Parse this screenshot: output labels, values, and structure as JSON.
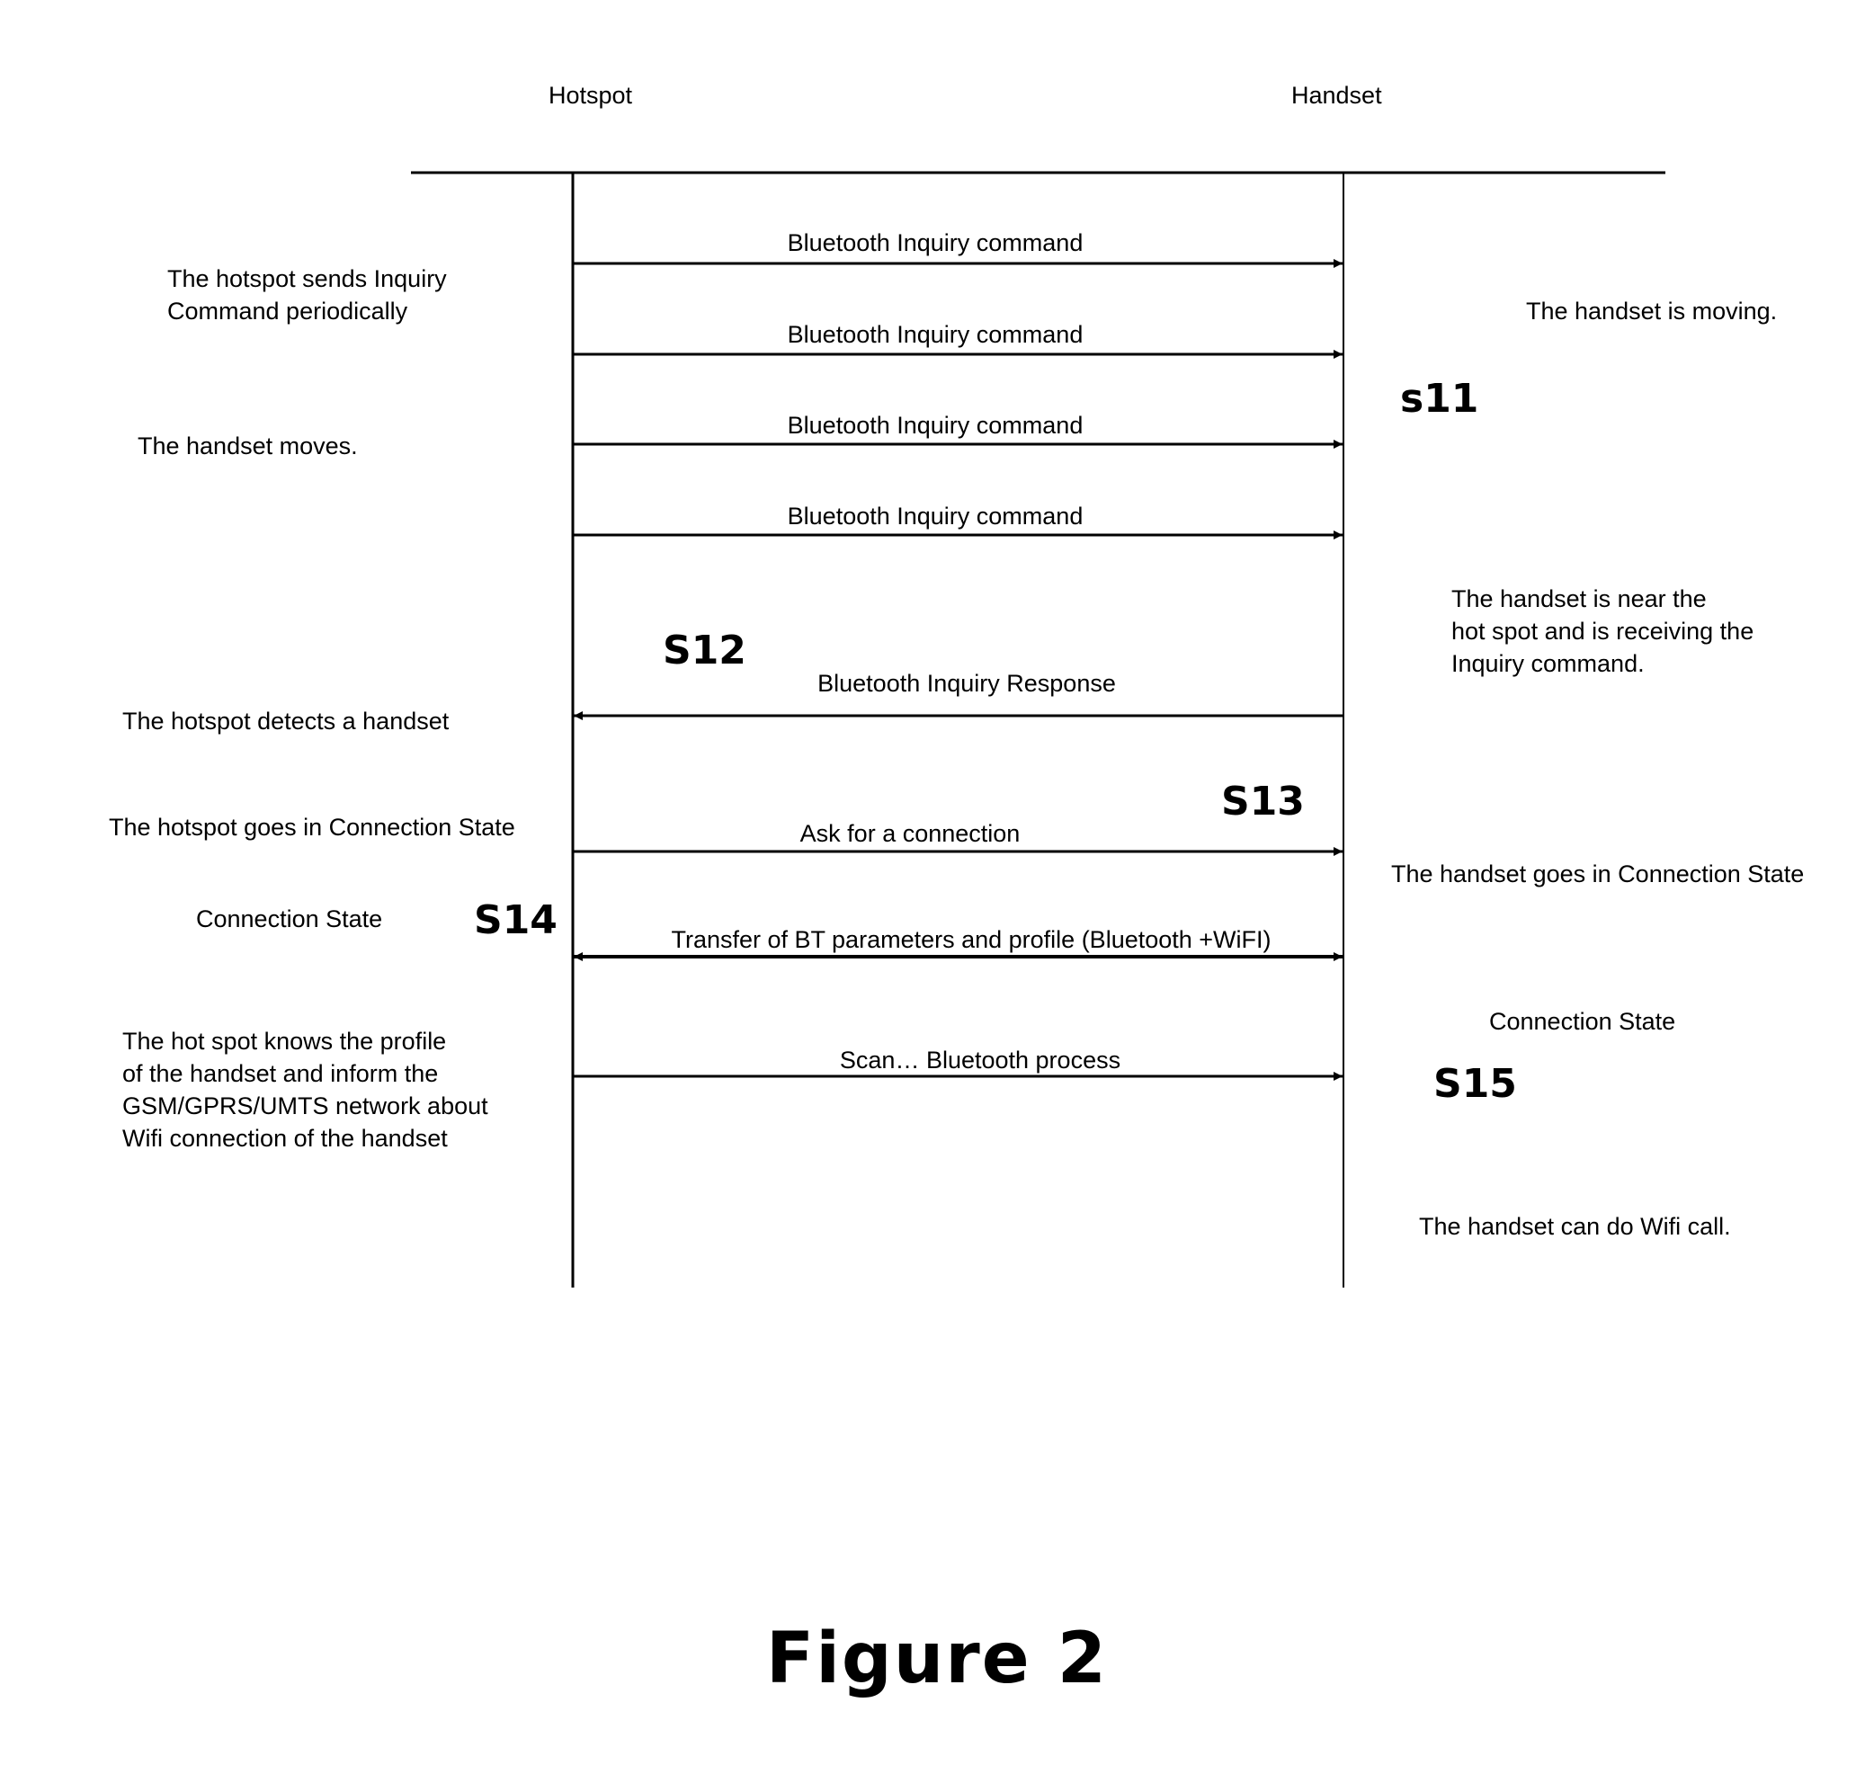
{
  "diagram": {
    "type": "sequence",
    "participants": [
      {
        "id": "hotspot",
        "label": "Hotspot"
      },
      {
        "id": "handset",
        "label": "Handset"
      }
    ],
    "messages": [
      {
        "label": "Bluetooth Inquiry command",
        "from": "hotspot",
        "to": "handset",
        "direction": "right"
      },
      {
        "label": "Bluetooth Inquiry command",
        "from": "hotspot",
        "to": "handset",
        "direction": "right"
      },
      {
        "label": "Bluetooth Inquiry command",
        "from": "hotspot",
        "to": "handset",
        "direction": "right"
      },
      {
        "label": "Bluetooth Inquiry command",
        "from": "hotspot",
        "to": "handset",
        "direction": "right"
      },
      {
        "label": "Bluetooth Inquiry Response",
        "from": "handset",
        "to": "hotspot",
        "direction": "left"
      },
      {
        "label": "Ask for a connection",
        "from": "hotspot",
        "to": "handset",
        "direction": "right"
      },
      {
        "label": "Transfer of BT parameters and profile (Bluetooth +WiFI)",
        "from": "hotspot",
        "to": "handset",
        "direction": "both"
      },
      {
        "label": "Scan… Bluetooth process",
        "from": "hotspot",
        "to": "handset",
        "direction": "right"
      }
    ],
    "steps": [
      "s11",
      "S12",
      "S13",
      "S14",
      "S15"
    ],
    "left_notes": [
      "The hotspot sends Inquiry\nCommand periodically",
      "The handset moves.",
      "The hotspot detects a handset",
      "The hotspot goes in Connection State",
      "Connection State",
      "The hot spot knows the profile\nof the handset and inform the\nGSM/GPRS/UMTS network about\nWifi connection of the handset"
    ],
    "right_notes": [
      "The handset is moving.",
      "The handset is near the\nhot spot and is receiving the\nInquiry command.",
      "The handset goes in Connection State",
      "Connection State",
      "The handset can do Wifi call."
    ],
    "caption": "Figure 2"
  }
}
